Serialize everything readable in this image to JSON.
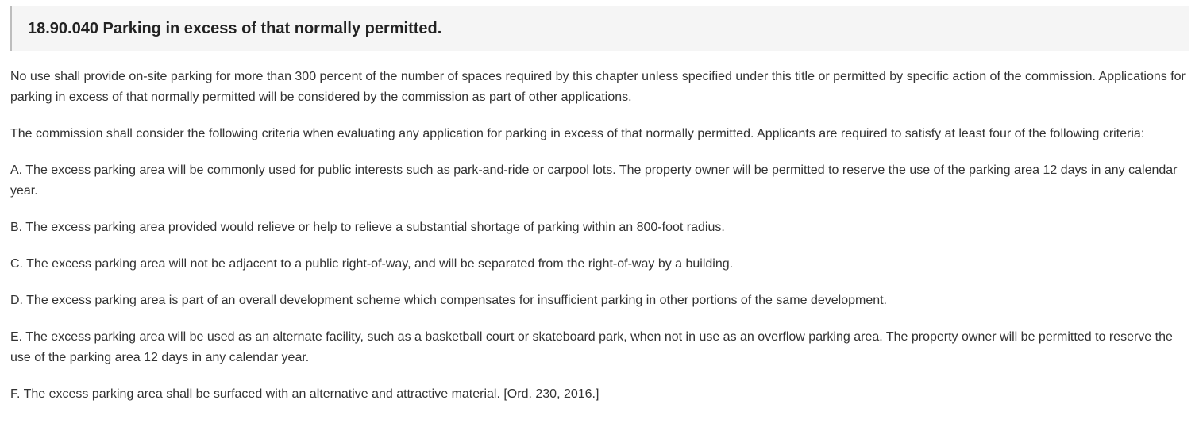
{
  "section": {
    "title": "18.90.040 Parking in excess of that normally permitted.",
    "paragraphs": [
      "No use shall provide on-site parking for more than 300 percent of the number of spaces required by this chapter unless specified under this title or permitted by specific action of the commission. Applications for parking in excess of that normally permitted will be considered by the commission as part of other applications.",
      "The commission shall consider the following criteria when evaluating any application for parking in excess of that normally permitted. Applicants are required to satisfy at least four of the following criteria:",
      "A. The excess parking area will be commonly used for public interests such as park-and-ride or carpool lots. The property owner will be permitted to reserve the use of the parking area 12 days in any calendar year.",
      "B. The excess parking area provided would relieve or help to relieve a substantial shortage of parking within an 800-foot radius.",
      "C. The excess parking area will not be adjacent to a public right-of-way, and will be separated from the right-of-way by a building.",
      "D. The excess parking area is part of an overall development scheme which compensates for insufficient parking in other portions of the same development.",
      "E. The excess parking area will be used as an alternate facility, such as a basketball court or skateboard park, when not in use as an overflow parking area. The property owner will be permitted to reserve the use of the parking area 12 days in any calendar year.",
      "F. The excess parking area shall be surfaced with an alternative and attractive material. [Ord. 230, 2016.]"
    ]
  }
}
